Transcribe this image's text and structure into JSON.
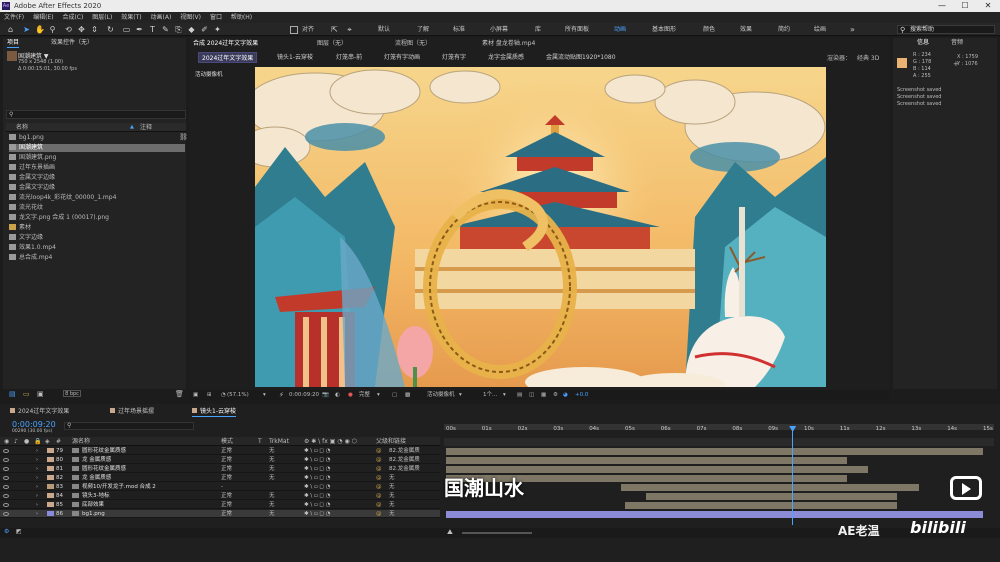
{
  "window": {
    "title": "Adobe After Effects 2020",
    "logo": "Ae",
    "controls": [
      "—",
      "☐",
      "✕"
    ]
  },
  "menu": [
    "文件(F)",
    "编辑(E)",
    "合成(C)",
    "图层(L)",
    "效果(T)",
    "动画(A)",
    "视图(V)",
    "窗口",
    "帮助(H)"
  ],
  "toolbar": {
    "align_label": "对齐",
    "workspaces": [
      "默认",
      "了解",
      "标准",
      "小屏幕",
      "库",
      "所有面板",
      "动画",
      "基本图形",
      "颜色",
      "效果",
      "简约",
      "绘画"
    ],
    "active_workspace": "动画",
    "search_placeholder": "搜索帮助"
  },
  "project": {
    "tab_project": "项目",
    "tab_effects": "效果控件（无）",
    "preview_name": "国潮建筑 ▼",
    "preview_size": "750 x 2548 (1.00)",
    "preview_dur": "Δ 0:00:15:01, 30.00 fps",
    "search_placeholder": "",
    "col_name": "名称",
    "col_comment": "注释",
    "items": [
      {
        "name": "bg1.png",
        "type": "file"
      },
      {
        "name": "国潮建筑",
        "type": "comp",
        "selected": true
      },
      {
        "name": "国潮建筑.png",
        "type": "file"
      },
      {
        "name": "过年东景插画",
        "type": "comp"
      },
      {
        "name": "金属文字边缘",
        "type": "comp"
      },
      {
        "name": "金属文字边缘",
        "type": "comp"
      },
      {
        "name": "流光loop4k_彩花纹_00000_1.mp4",
        "type": "file"
      },
      {
        "name": "流光花纹",
        "type": "comp"
      },
      {
        "name": "龙文字.png 合成 1 (00017).png",
        "type": "file"
      },
      {
        "name": "素材",
        "type": "folder"
      },
      {
        "name": "文字边缘",
        "type": "comp"
      },
      {
        "name": "效果1.0.mp4",
        "type": "file"
      },
      {
        "name": "总合成.mp4",
        "type": "file"
      }
    ],
    "bpc": "8 bpc"
  },
  "composition": {
    "tabs": [
      "合成 2024过年文字效果",
      "图层（无）",
      "流程图（无）",
      "素材 盘龙卷轴.mp4"
    ],
    "crumbs": [
      "2024过年文字效果",
      "镜头1-云穿梭",
      "灯笼串-前",
      "灯笼有字动画",
      "灯笼有字",
      "龙字金属质感",
      "金属流动贴图1920*1080"
    ],
    "renderer_label": "渲染器：",
    "renderer_value": "经典 3D",
    "camera_label": "活动摄像机",
    "zoom": "(57.1%)",
    "timecode": "0:00:09:20",
    "quality": "完整",
    "camera": "活动摄像机",
    "views": "1个...",
    "exposure": "+0.0"
  },
  "info": {
    "tab_info": "信息",
    "tab_audio": "音频",
    "swatch_color": "#eab272",
    "r": "R : 234",
    "g": "G : 178",
    "b": "B : 114",
    "a": "A : 255",
    "x": "X : 1759",
    "y": "Y : 1076",
    "log": [
      "Screenshot saved",
      "Screenshot saved",
      "Screenshot saved"
    ]
  },
  "timeline": {
    "tabs": [
      "2024过年文字效果",
      "过年场景摇摆",
      "镜头1-云穿梭"
    ],
    "timecode": "0:00:09:20",
    "timecode_sub": "00290 (30.00 fps)",
    "headers": {
      "name": "源名称",
      "mode": "模式",
      "t": "T",
      "trkmat": "TrkMat",
      "parent": "父级和链接"
    },
    "ruler": [
      "00s",
      "01s",
      "02s",
      "03s",
      "04s",
      "05s",
      "06s",
      "07s",
      "08s",
      "09s",
      "10s",
      "11s",
      "12s",
      "13s",
      "14s",
      "15s"
    ],
    "playhead_seconds": 9.67,
    "layers": [
      {
        "num": "79",
        "name": "圆形花纹金属质感",
        "mode": "正常",
        "trk": "无",
        "parent": "82.龙金属质",
        "start": 0,
        "end": 15,
        "label": "#c9a88b"
      },
      {
        "num": "80",
        "name": "龙 金属质感",
        "mode": "正常",
        "trk": "无",
        "parent": "82.龙金属质",
        "start": 0,
        "end": 11.2,
        "label": "#c9a88b"
      },
      {
        "num": "81",
        "name": "圆形花纹金属质感",
        "mode": "正常",
        "trk": "无",
        "parent": "82.龙金属质",
        "start": 0,
        "end": 11.8,
        "label": "#c9a88b"
      },
      {
        "num": "82",
        "name": "龙 金属质感",
        "mode": "正常",
        "trk": "无",
        "parent": "无",
        "start": 0,
        "end": 11.2,
        "label": "#c9a88b"
      },
      {
        "num": "83",
        "name": "视频10/开发龙子.mod 合成 2",
        "mode": "-",
        "trk": "",
        "parent": "无",
        "start": 4.9,
        "end": 13.2,
        "label": "#b79a7a"
      },
      {
        "num": "84",
        "name": "镜头3-地标",
        "mode": "正常",
        "trk": "无",
        "parent": "无",
        "start": 5.6,
        "end": 12.6,
        "label": "#c9a88b"
      },
      {
        "num": "85",
        "name": "底部效果",
        "mode": "正常",
        "trk": "无",
        "parent": "无",
        "start": 5.0,
        "end": 12.6,
        "label": "#c9a88b"
      },
      {
        "num": "86",
        "name": "bg1.png",
        "mode": "正常",
        "trk": "无",
        "parent": "无",
        "start": 0,
        "end": 15,
        "label": "#8a8adc",
        "selected": true
      }
    ],
    "ruler_start_label": "0s"
  },
  "overlay": {
    "caption": "国潮山水",
    "watermark": "AE老温",
    "brand": "bilibili"
  }
}
